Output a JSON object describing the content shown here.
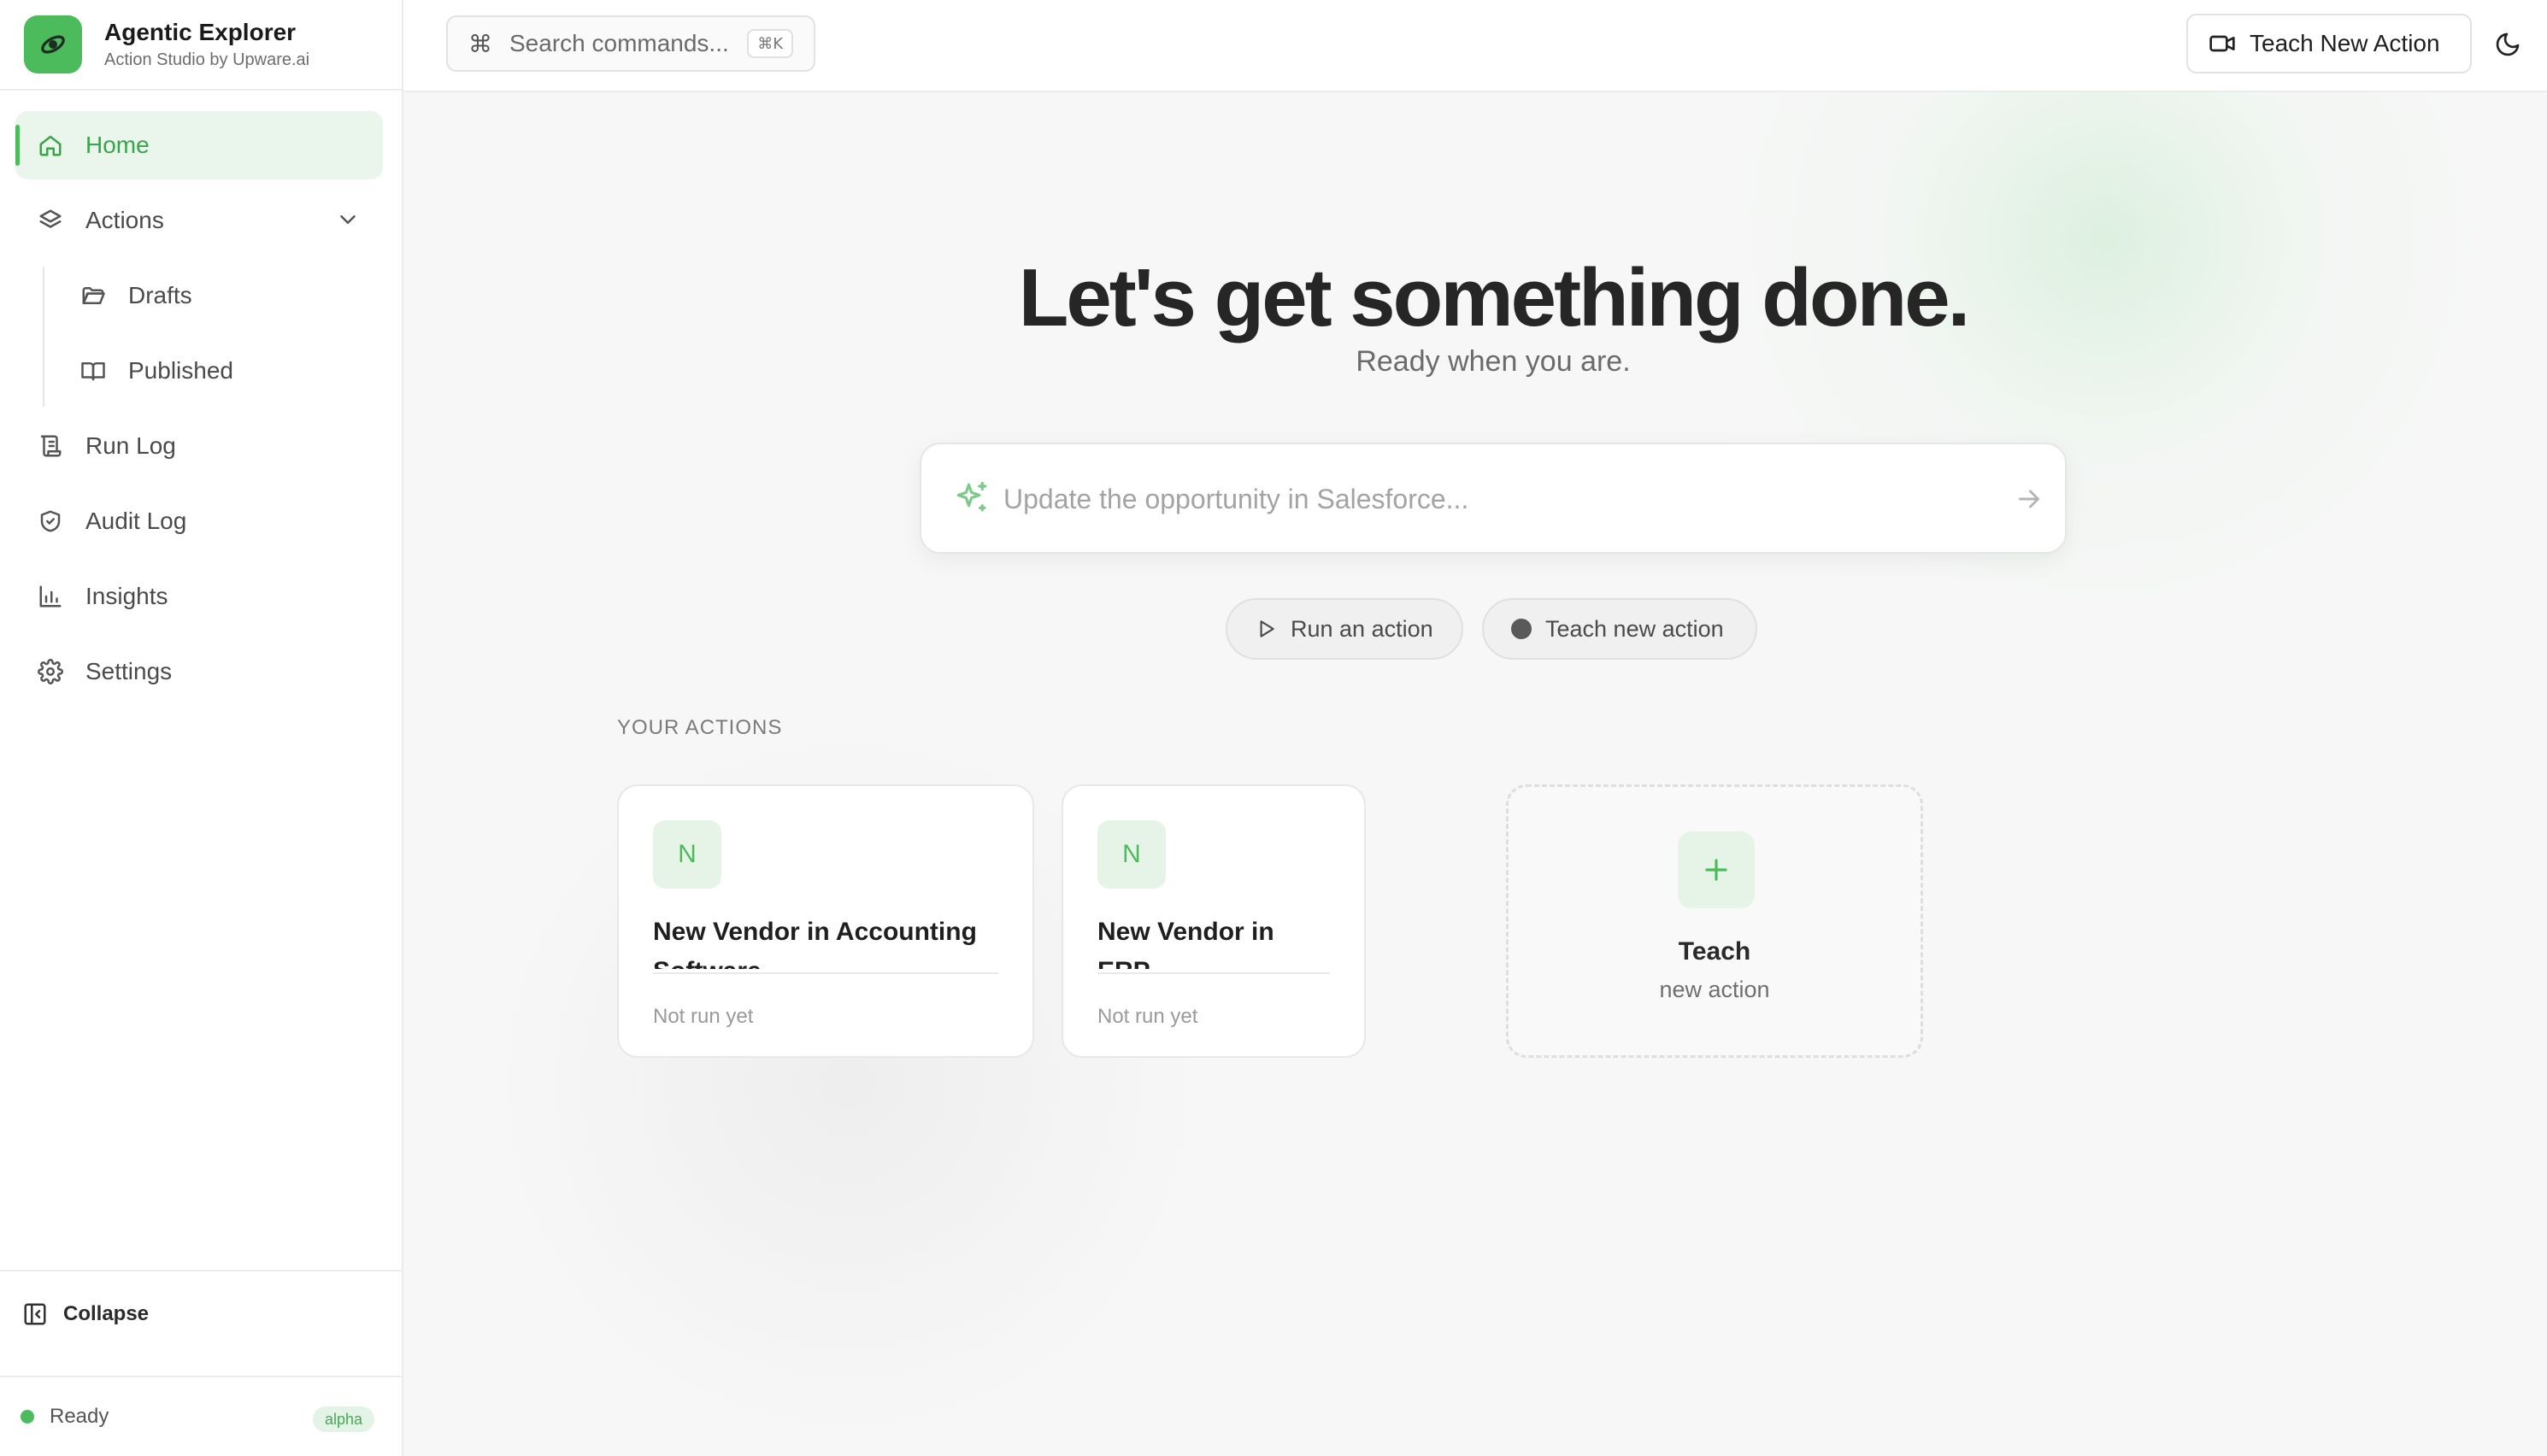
{
  "app": {
    "title": "Agentic Explorer",
    "subtitle": "Action Studio by Upware.ai"
  },
  "sidebar": {
    "items": [
      {
        "label": "Home",
        "icon": "home-icon",
        "active": true
      },
      {
        "label": "Actions",
        "icon": "layers-icon",
        "expandable": true
      },
      {
        "label": "Drafts",
        "icon": "folder-open-icon",
        "sub": true
      },
      {
        "label": "Published",
        "icon": "book-open-icon",
        "sub": true
      },
      {
        "label": "Run Log",
        "icon": "scroll-icon"
      },
      {
        "label": "Audit Log",
        "icon": "shield-check-icon"
      },
      {
        "label": "Insights",
        "icon": "bar-chart-icon"
      },
      {
        "label": "Settings",
        "icon": "gear-icon"
      }
    ],
    "collapse_label": "Collapse",
    "status": {
      "text": "Ready",
      "badge": "alpha"
    }
  },
  "topbar": {
    "search_label": "Search commands...",
    "search_shortcut": "⌘K",
    "teach_button": "Teach New Action",
    "theme_icon": "moon-icon"
  },
  "hero": {
    "title": "Let's get something done.",
    "subtitle": "Ready when you are."
  },
  "prompt": {
    "placeholder": "Update the opportunity in Salesforce...",
    "value": ""
  },
  "quick_actions": {
    "run_label": "Run an action",
    "teach_label": "Teach new action"
  },
  "actions_section": {
    "label": "YOUR ACTIONS",
    "cards": [
      {
        "initial": "N",
        "title": "New Vendor in Accounting Software",
        "status": "Not run yet"
      },
      {
        "initial": "N",
        "title": "New Vendor in ERP",
        "status": "Not run yet"
      }
    ],
    "teach_card": {
      "title": "Teach",
      "subtitle": "new action"
    }
  },
  "colors": {
    "accent": "#4cbb5c",
    "accent_soft": "#eaf6ec",
    "background": "#f7f7f7"
  }
}
